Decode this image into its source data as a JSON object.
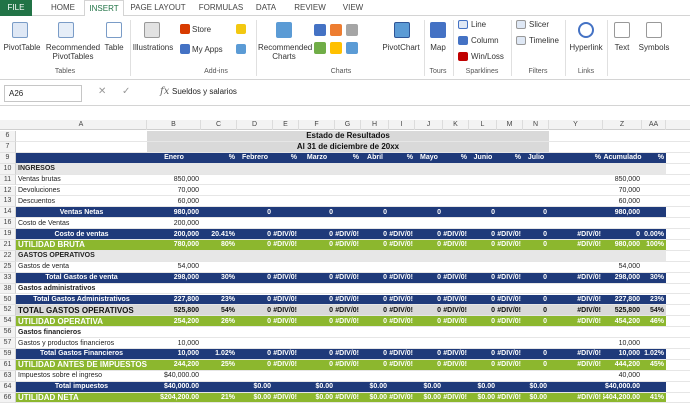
{
  "tabs": [
    "FILE",
    "HOME",
    "INSERT",
    "PAGE LAYOUT",
    "FORMULAS",
    "DATA",
    "REVIEW",
    "VIEW"
  ],
  "ribbon": {
    "pivottable": "PivotTable",
    "recommended_pivottables": "Recommended PivotTables",
    "table": "Table",
    "group_tables": "Tables",
    "illustrations": "Illustrations",
    "store": "Store",
    "my_apps": "My Apps",
    "group_addins": "Add-ins",
    "recommended_charts": "Recommended Charts",
    "pivotchart": "PivotChart",
    "group_charts": "Charts",
    "map": "Map",
    "group_tours": "Tours",
    "line": "Line",
    "column": "Column",
    "winloss": "Win/Loss",
    "group_sparklines": "Sparklines",
    "slicer": "Slicer",
    "timeline": "Timeline",
    "group_filters": "Filters",
    "hyperlink": "Hyperlink",
    "group_links": "Links",
    "text": "Text",
    "symbols": "Symbols"
  },
  "formula_bar": {
    "name_box": "A26",
    "fx": "fx",
    "value": "Sueldos y salarios"
  },
  "columns": [
    "A",
    "B",
    "C",
    "D",
    "E",
    "F",
    "G",
    "H",
    "I",
    "J",
    "K",
    "L",
    "M",
    "N",
    "Y",
    "Z",
    "AA"
  ],
  "title1": "Estado de Resultados",
  "title2": "Al 31 de diciembre de 20xx",
  "header_row": [
    "Enero",
    "%",
    "Febrero",
    "%",
    "Marzo",
    "%",
    "Abril",
    "%",
    "Mayo",
    "%",
    "Junio",
    "%",
    "Julio",
    "%",
    "Acumulado",
    "%"
  ],
  "rows": [
    {
      "n": "6",
      "style": "title",
      "cells": []
    },
    {
      "n": "7",
      "style": "title2",
      "cells": []
    },
    {
      "n": "9",
      "style": "header",
      "cells": []
    },
    {
      "n": "10",
      "style": "section",
      "label": "INGRESOS",
      "cells": []
    },
    {
      "n": "11",
      "style": "plain",
      "label": "Ventas brutas",
      "cells": [
        "850,000",
        "",
        "",
        "",
        "",
        "",
        "",
        "",
        "",
        "",
        "",
        "",
        "",
        "",
        "850,000",
        ""
      ]
    },
    {
      "n": "12",
      "style": "plain",
      "label": "Devoluciones",
      "cells": [
        "70,000",
        "",
        "",
        "",
        "",
        "",
        "",
        "",
        "",
        "",
        "",
        "",
        "",
        "",
        "70,000",
        ""
      ]
    },
    {
      "n": "13",
      "style": "plain",
      "label": "Descuentos",
      "cells": [
        "60,000",
        "",
        "",
        "",
        "",
        "",
        "",
        "",
        "",
        "",
        "",
        "",
        "",
        "",
        "60,000",
        ""
      ]
    },
    {
      "n": "14",
      "style": "navy",
      "label": "Ventas Netas",
      "cells": [
        "980,000",
        "",
        "0",
        "",
        "0",
        "",
        "0",
        "",
        "0",
        "",
        "0",
        "",
        "0",
        "",
        "980,000",
        ""
      ]
    },
    {
      "n": "16",
      "style": "plain",
      "label": "Costo de Ventas",
      "cells": [
        "200,000",
        "",
        "",
        "",
        "",
        "",
        "",
        "",
        "",
        "",
        "",
        "",
        "",
        "",
        "",
        ""
      ]
    },
    {
      "n": "19",
      "style": "navy",
      "label": "Costo de ventas",
      "cells": [
        "200,000",
        "20.41%",
        "0",
        "#DIV/0!",
        "0",
        "#DIV/0!",
        "0",
        "#DIV/0!",
        "0",
        "#DIV/0!",
        "0",
        "#DIV/0!",
        "0",
        "#DIV/0!",
        "0",
        "0.00%"
      ]
    },
    {
      "n": "21",
      "style": "green",
      "label": "UTILIDAD BRUTA",
      "cells": [
        "780,000",
        "80%",
        "0",
        "#DIV/0!",
        "0",
        "#DIV/0!",
        "0",
        "#DIV/0!",
        "0",
        "#DIV/0!",
        "0",
        "#DIV/0!",
        "0",
        "#DIV/0!",
        "980,000",
        "100%"
      ]
    },
    {
      "n": "22",
      "style": "section",
      "label": "GASTOS OPERATIVOS",
      "cells": []
    },
    {
      "n": "25",
      "style": "plain",
      "label": "Gastos de venta",
      "cells": [
        "54,000",
        "",
        "",
        "",
        "",
        "",
        "",
        "",
        "",
        "",
        "",
        "",
        "",
        "",
        "54,000",
        ""
      ]
    },
    {
      "n": "33",
      "style": "navy",
      "label": "Total Gastos de venta",
      "cells": [
        "298,000",
        "30%",
        "0",
        "#DIV/0!",
        "0",
        "#DIV/0!",
        "0",
        "#DIV/0!",
        "0",
        "#DIV/0!",
        "0",
        "#DIV/0!",
        "0",
        "#DIV/0!",
        "298,000",
        "30%"
      ]
    },
    {
      "n": "38",
      "style": "plainbold",
      "label": "Gastos administrativos",
      "cells": []
    },
    {
      "n": "50",
      "style": "navy",
      "label": "Total Gastos Administrativos",
      "cells": [
        "227,800",
        "23%",
        "0",
        "#DIV/0!",
        "0",
        "#DIV/0!",
        "0",
        "#DIV/0!",
        "0",
        "#DIV/0!",
        "0",
        "#DIV/0!",
        "0",
        "#DIV/0!",
        "227,800",
        "23%"
      ]
    },
    {
      "n": "52",
      "style": "grey",
      "label": "TOTAL GASTOS OPERATIVOS",
      "cells": [
        "525,800",
        "54%",
        "0",
        "#DIV/0!",
        "0",
        "#DIV/0!",
        "0",
        "#DIV/0!",
        "0",
        "#DIV/0!",
        "0",
        "#DIV/0!",
        "0",
        "#DIV/0!",
        "525,800",
        "54%"
      ]
    },
    {
      "n": "54",
      "style": "green",
      "label": "UTILIDAD OPERATIVA",
      "cells": [
        "254,200",
        "26%",
        "0",
        "#DIV/0!",
        "0",
        "#DIV/0!",
        "0",
        "#DIV/0!",
        "0",
        "#DIV/0!",
        "0",
        "#DIV/0!",
        "0",
        "#DIV/0!",
        "454,200",
        "46%"
      ]
    },
    {
      "n": "56",
      "style": "plainbold",
      "label": "Gastos financieros",
      "cells": []
    },
    {
      "n": "57",
      "style": "plain",
      "label": "Gastos y productos financieros",
      "cells": [
        "10,000",
        "",
        "",
        "",
        "",
        "",
        "",
        "",
        "",
        "",
        "",
        "",
        "",
        "",
        "10,000",
        ""
      ]
    },
    {
      "n": "59",
      "style": "navy",
      "label": "Total Gastos Financieros",
      "cells": [
        "10,000",
        "1.02%",
        "0",
        "#DIV/0!",
        "0",
        "#DIV/0!",
        "0",
        "#DIV/0!",
        "0",
        "#DIV/0!",
        "0",
        "#DIV/0!",
        "0",
        "#DIV/0!",
        "10,000",
        "1.02%"
      ]
    },
    {
      "n": "61",
      "style": "green",
      "label": "UTILIDAD ANTES DE IMPUESTOS",
      "cells": [
        "244,200",
        "25%",
        "0",
        "#DIV/0!",
        "0",
        "#DIV/0!",
        "0",
        "#DIV/0!",
        "0",
        "#DIV/0!",
        "0",
        "#DIV/0!",
        "0",
        "#DIV/0!",
        "444,200",
        "45%"
      ]
    },
    {
      "n": "63",
      "style": "plain",
      "label": "Impuestos sobre el ingreso",
      "cells": [
        "$40,000.00",
        "",
        "",
        "",
        "",
        "",
        "",
        "",
        "",
        "",
        "",
        "",
        "",
        "",
        "40,000",
        ""
      ]
    },
    {
      "n": "64",
      "style": "navy",
      "label": "Total impuestos",
      "cells": [
        "$40,000.00",
        "",
        "$0.00",
        "",
        "$0.00",
        "",
        "$0.00",
        "",
        "$0.00",
        "",
        "$0.00",
        "",
        "$0.00",
        "",
        "$40,000.00",
        ""
      ]
    },
    {
      "n": "66",
      "style": "green",
      "label": "UTILIDAD NETA",
      "cells": [
        "$204,200.00",
        "21%",
        "$0.00",
        "#DIV/0!",
        "$0.00",
        "#DIV/0!",
        "$0.00",
        "#DIV/0!",
        "$0.00",
        "#DIV/0!",
        "$0.00",
        "#DIV/0!",
        "$0.00",
        "#DIV/0!",
        "$404,200.00",
        "41%"
      ]
    }
  ],
  "colors": {
    "navy": "#1f3a7a",
    "green": "#8cb72e",
    "excel_green": "#217346"
  }
}
